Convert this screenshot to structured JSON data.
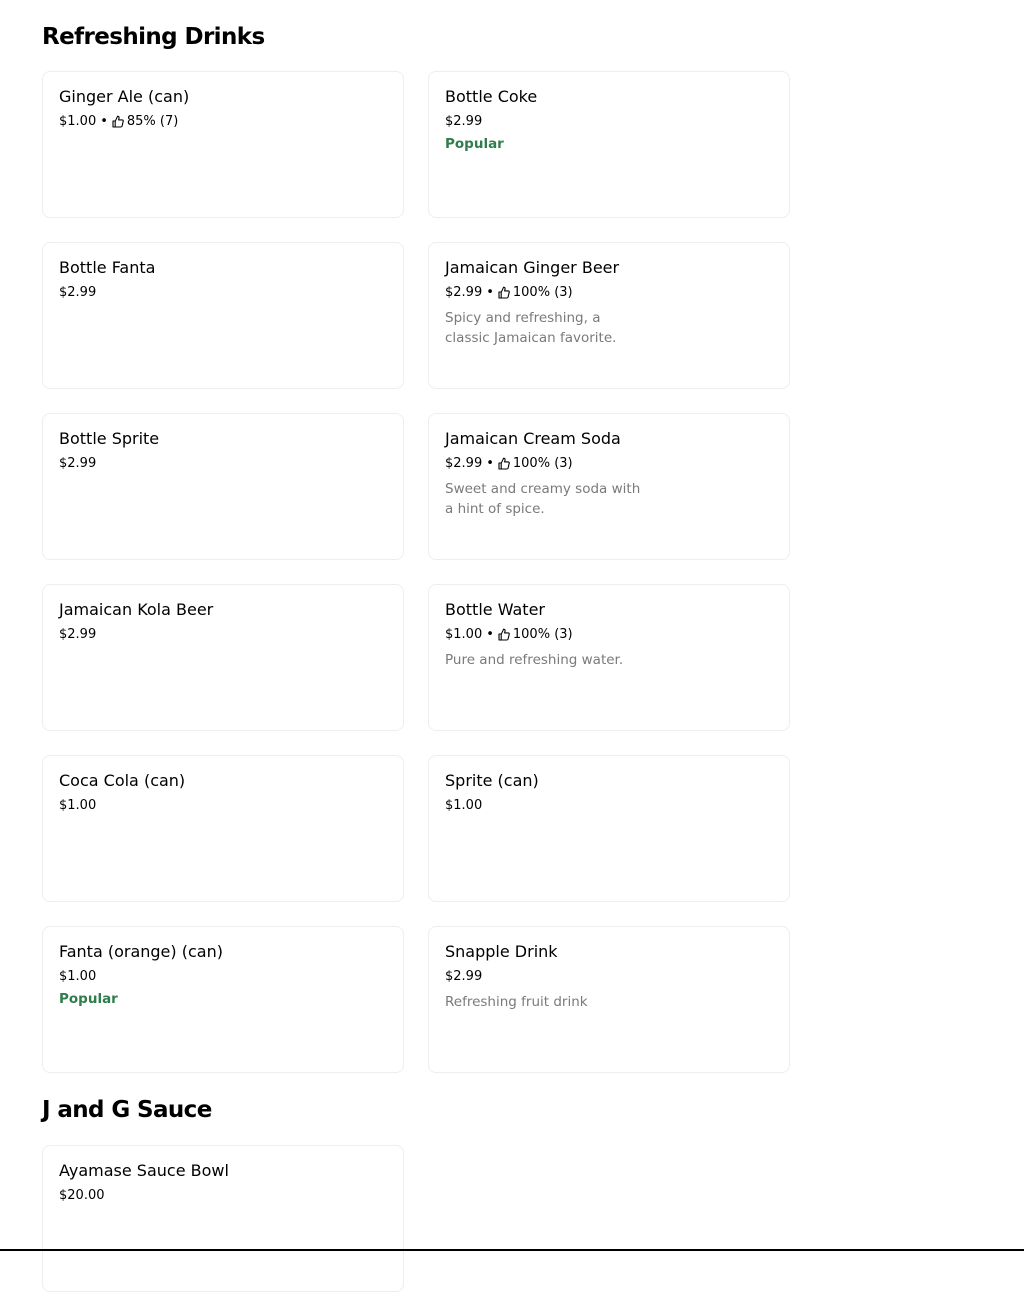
{
  "sections": {
    "drinks": {
      "title": "Refreshing Drinks"
    },
    "sauce": {
      "title": "J and G Sauce"
    }
  },
  "items": [
    {
      "name": "Ginger Ale (can)",
      "price": "$1.00",
      "rating": "85% (7)"
    },
    {
      "name": "Bottle Coke",
      "price": "$2.99",
      "tag": "Popular"
    },
    {
      "name": "Bottle Fanta",
      "price": "$2.99"
    },
    {
      "name": "Jamaican Ginger Beer",
      "price": "$2.99",
      "rating": "100% (3)",
      "description": "Spicy and refreshing, a classic Jamaican favorite."
    },
    {
      "name": "Bottle Sprite",
      "price": "$2.99"
    },
    {
      "name": "Jamaican Cream Soda",
      "price": "$2.99",
      "rating": "100% (3)",
      "description": "Sweet and creamy soda with a hint of spice."
    },
    {
      "name": "Jamaican Kola Beer",
      "price": "$2.99"
    },
    {
      "name": "Bottle Water",
      "price": "$1.00",
      "rating": "100% (3)",
      "description": "Pure and refreshing water."
    },
    {
      "name": "Coca Cola (can)",
      "price": "$1.00"
    },
    {
      "name": "Sprite (can)",
      "price": "$1.00"
    },
    {
      "name": "Fanta (orange) (can)",
      "price": "$1.00",
      "tag": "Popular"
    },
    {
      "name": "Snapple Drink",
      "price": "$2.99",
      "description": "Refreshing fruit drink"
    },
    {
      "name": "Ayamase Sauce Bowl",
      "price": "$20.00"
    }
  ],
  "meta_separator": "•",
  "icons": {
    "rating": "thumbs-up-icon"
  },
  "colors": {
    "popular": "#2e7d4a",
    "description": "#7a7a7a",
    "card_border": "#eeeeee"
  }
}
